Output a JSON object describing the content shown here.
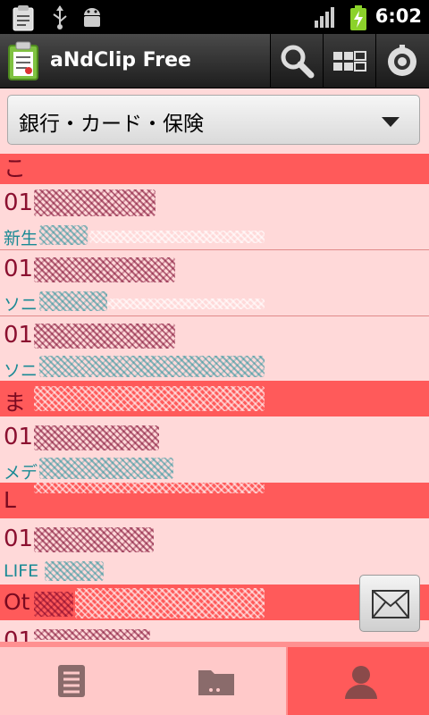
{
  "status_bar": {
    "time": "6:02"
  },
  "app": {
    "title": "aNdClip Free"
  },
  "toolbar": {
    "icons": [
      "search-icon",
      "layout-icon",
      "settings-icon"
    ]
  },
  "category_dropdown": {
    "selected": "銀行・カード・保険"
  },
  "list": {
    "items": [
      {
        "kind": "header",
        "text": "こ"
      },
      {
        "kind": "number",
        "text": "01"
      },
      {
        "kind": "sub",
        "text": "新生"
      },
      {
        "kind": "number",
        "text": "01"
      },
      {
        "kind": "sub",
        "text": "ソニ"
      },
      {
        "kind": "number",
        "text": "01"
      },
      {
        "kind": "sub",
        "text": "ソニ"
      },
      {
        "kind": "header",
        "text": "ま"
      },
      {
        "kind": "number",
        "text": "01"
      },
      {
        "kind": "sub",
        "text": "メデ"
      },
      {
        "kind": "header",
        "text": "L"
      },
      {
        "kind": "number",
        "text": "01"
      },
      {
        "kind": "sub",
        "text": "LIFE"
      },
      {
        "kind": "header",
        "text": "Ot"
      },
      {
        "kind": "number",
        "text": "01"
      }
    ]
  },
  "bottom_tabs": [
    {
      "icon": "document-icon"
    },
    {
      "icon": "folder-icon"
    },
    {
      "icon": "person-icon"
    }
  ],
  "colors": {
    "header_bg": "#ff5a5a",
    "list_bg": "#ffd9d9",
    "number_text": "#8b1030",
    "sub_text": "#1a8a95"
  }
}
